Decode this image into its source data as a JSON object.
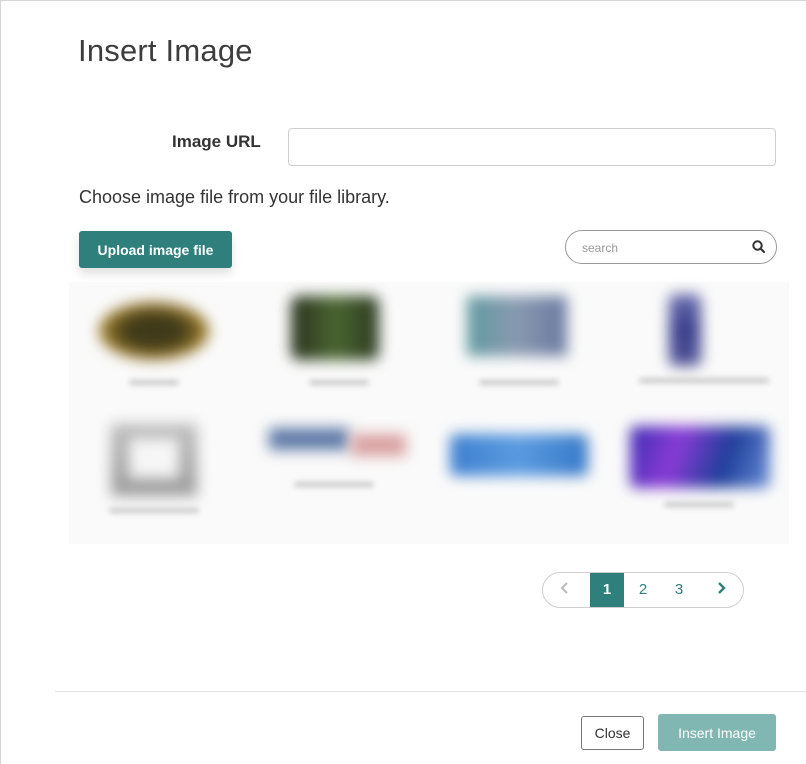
{
  "dialog": {
    "title": "Insert Image"
  },
  "url_field": {
    "label": "Image URL",
    "value": "",
    "placeholder": ""
  },
  "library": {
    "instruction": "Choose image file from your file library.",
    "upload_label": "Upload image file",
    "search_placeholder": "search",
    "search_icon": "magnifier-icon"
  },
  "pagination": {
    "prev_icon": "chevron-left-icon",
    "next_icon": "chevron-right-icon",
    "pages": [
      "1",
      "2",
      "3"
    ],
    "current_page": "1"
  },
  "footer": {
    "close_label": "Close",
    "insert_label": "Insert Image"
  },
  "colors": {
    "accent": "#2f7f7c",
    "accent_disabled": "#80b7b3"
  }
}
